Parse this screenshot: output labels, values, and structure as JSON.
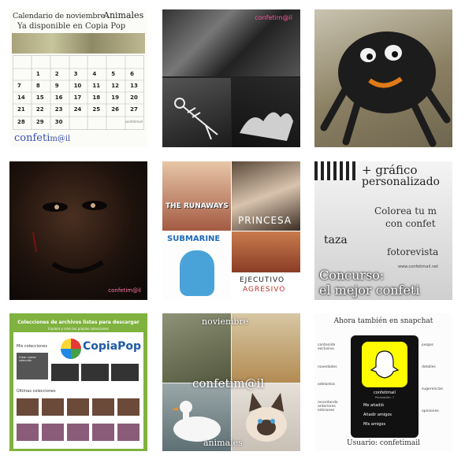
{
  "tiles": {
    "calendar": {
      "line1": "Calendario de noviembre",
      "line2": "Ya disponible en Copia Pop",
      "animals": "Animales",
      "footer_logo": "confeti",
      "footer_logo2": "m@il",
      "tiny_mark": "confetimail",
      "days": [
        "1",
        "2",
        "3",
        "4",
        "5",
        "6",
        "7",
        "8",
        "9",
        "10",
        "11",
        "12",
        "13",
        "14",
        "15",
        "16",
        "17",
        "18",
        "19",
        "20",
        "21",
        "22",
        "23",
        "24",
        "25",
        "26",
        "27",
        "28",
        "29",
        "30"
      ]
    },
    "halloween_bw": {
      "watermark": "confetim@il"
    },
    "spider_plush": {},
    "dark_face": {
      "watermark": "confetim@il"
    },
    "movies": {
      "runaways": "THE RUNAWAYS",
      "princesa": "PRINCESA",
      "submarine": "SUBMARINE",
      "ejecutivo": "EJECUTIVO",
      "agresivo": "AGRESIVO"
    },
    "contest": {
      "line1": "+ gráfico",
      "line2": "personalizado",
      "line3": "Colorea tu m",
      "line4": "con confet",
      "taza": "taza",
      "fotorevista": "fotorevista",
      "concurso": "Concurso:",
      "mejor": "el mejor confeti",
      "site": "www.confetimail.net"
    },
    "copiapop": {
      "header": "Colecciones de archivos listas para descargar",
      "sub": "Explora y crea tus propias colecciones",
      "logo": "CopiaPop",
      "mis": "Mis colecciones",
      "crear": "Crear nueva colección",
      "ultimas": "Últimas colecciones"
    },
    "animals_collage": {
      "top": "noviembre",
      "middle": "confetim@il",
      "bottom": "animales"
    },
    "snapchat": {
      "title": "Ahora también en snapchat",
      "left": [
        "contenido exclusivo",
        "novedades",
        "adelantos",
        "recordando anteriores ediciones"
      ],
      "right": [
        "juegos",
        "detalles",
        "sugerencias",
        "opiniones"
      ],
      "user": "confetimail",
      "points": "Puntuación: 7",
      "menu": [
        "Me añadió",
        "Añadir amigos",
        "Mis amigos"
      ],
      "footer": "Usuario: confetimail"
    }
  }
}
